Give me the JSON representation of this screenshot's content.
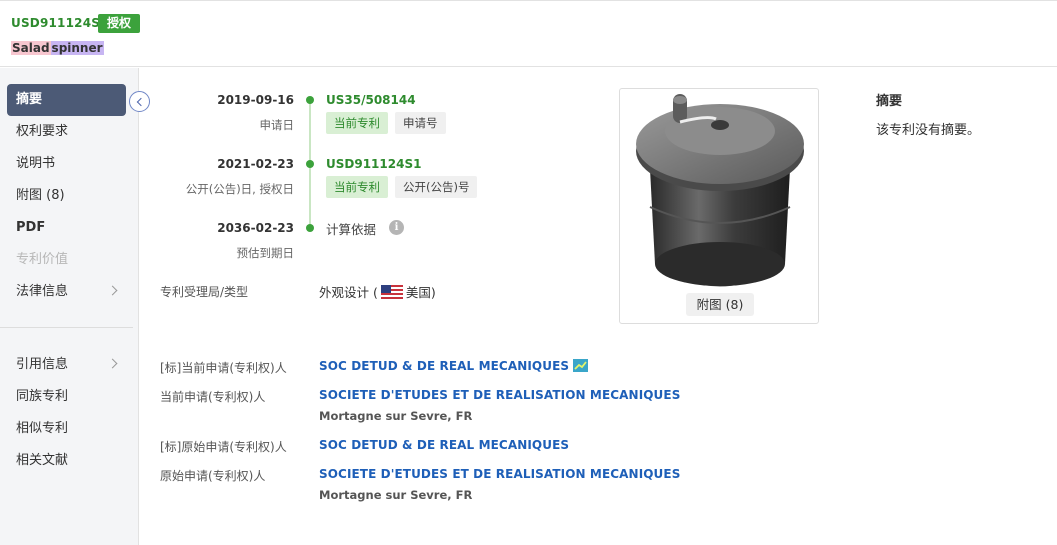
{
  "header": {
    "pub_number": "USD911124S1",
    "status": "授权",
    "title_word1": "Salad",
    "title_word2": "spinner"
  },
  "sidebar": {
    "items": [
      {
        "label": "摘要"
      },
      {
        "label": "权利要求"
      },
      {
        "label": "说明书"
      },
      {
        "label": "附图 (8)"
      },
      {
        "label": "PDF"
      },
      {
        "label": "专利价值"
      },
      {
        "label": "法律信息"
      },
      {
        "label": "引用信息"
      },
      {
        "label": "同族专利"
      },
      {
        "label": "相似专利"
      },
      {
        "label": "相关文献"
      }
    ]
  },
  "timeline": {
    "application": {
      "date": "2019-09-16",
      "label": "申请日",
      "number": "US35/508144",
      "tag1": "当前专利",
      "tag2": "申请号"
    },
    "publication": {
      "date": "2021-02-23",
      "label": "公开(公告)日, 授权日",
      "number": "USD911124S1",
      "tag1": "当前专利",
      "tag2": "公开(公告)号"
    },
    "expiry": {
      "date": "2036-02-23",
      "label": "预估到期日",
      "calc": "计算依据",
      "info_icon": "i"
    }
  },
  "fields": {
    "office_type_label": "专利受理局/类型",
    "office_type_value": "外观设计 (",
    "office_country": "美国)",
    "std_current_label": "[标]当前申请(专利权)人",
    "std_current_value": "SOC DETUD & DE REAL MECANIQUES",
    "current_label": "当前申请(专利权)人",
    "current_value": "SOCIETE D'ETUDES ET DE REALISATION MECANIQUES",
    "current_addr": "Mortagne sur Sevre, FR",
    "std_original_label": "[标]原始申请(专利权)人",
    "std_original_value": "SOC DETUD & DE REAL MECANIQUES",
    "original_label": "原始申请(专利权)人",
    "original_value": "SOCIETE D'ETUDES ET DE REALISATION MECANIQUES",
    "original_addr": "Mortagne sur Sevre, FR"
  },
  "figure": {
    "button": "附图 (8)"
  },
  "abstract": {
    "title": "摘要",
    "text": "该专利没有摘要。"
  },
  "colors": {
    "accent_green": "#3ca23c",
    "link_blue": "#1e5fb8",
    "sidebar_active": "#4c5a76"
  }
}
